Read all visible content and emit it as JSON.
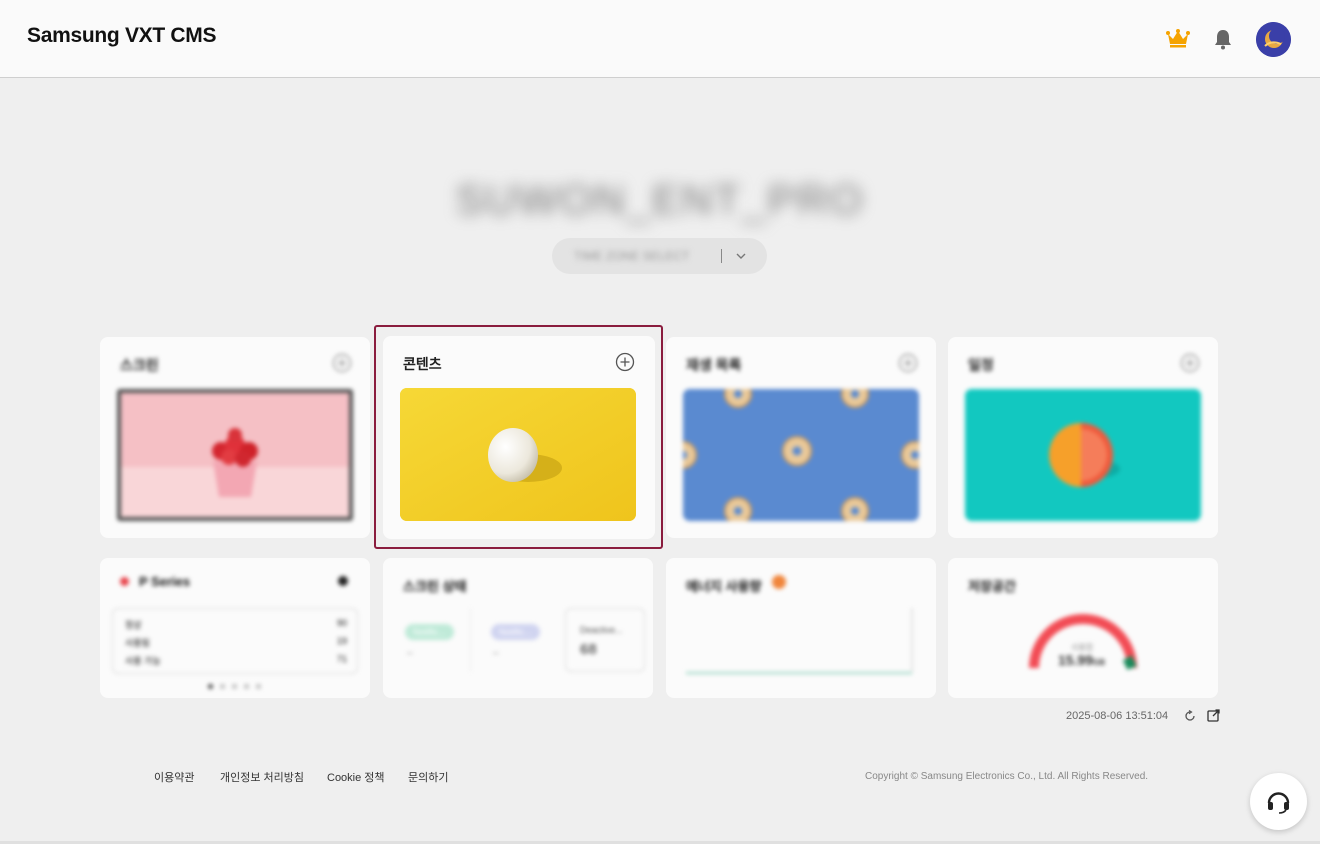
{
  "header": {
    "logo": "Samsung VXT CMS",
    "icons": [
      "crown-icon",
      "bell-icon",
      "avatar"
    ],
    "accent": "#f5a300"
  },
  "org": {
    "name": "SUWON_ENT_PRO",
    "selector_text": "TIME ZONE SELECT"
  },
  "cards": {
    "screen": {
      "title": "스크린"
    },
    "content": {
      "title": "콘텐츠"
    },
    "playlist": {
      "title": "재생 목록"
    },
    "schedule": {
      "title": "일정"
    }
  },
  "widgets": {
    "series": {
      "title": "P Series",
      "rows": [
        {
          "label": "정상",
          "value": "90"
        },
        {
          "label": "사용됨",
          "value": "19"
        },
        {
          "label": "사용 가능",
          "value": "71"
        }
      ]
    },
    "screen_status": {
      "title": "스크린 상태",
      "pill_1": "Notific...",
      "pill_2": "Notific...",
      "dash_1": "–",
      "dash_2": "–",
      "deactive_label": "Deactive...",
      "deactive_value": "68"
    },
    "energy": {
      "title": "에너지 사용량"
    },
    "storage": {
      "title": "저장공간",
      "label": "사용함",
      "value": "15.99",
      "unit": "GB"
    }
  },
  "status": {
    "timestamp": "2025-08-06 13:51:04"
  },
  "footer": {
    "terms": "이용약관",
    "privacy": "개인정보 처리방침",
    "cookie": "Cookie 정책",
    "contact": "문의하기",
    "copyright": "Copyright © Samsung Electronics Co., Ltd. All Rights Reserved."
  },
  "colors": {
    "highlight": "#8a1c3e",
    "avatar": "#3a3fa8"
  }
}
